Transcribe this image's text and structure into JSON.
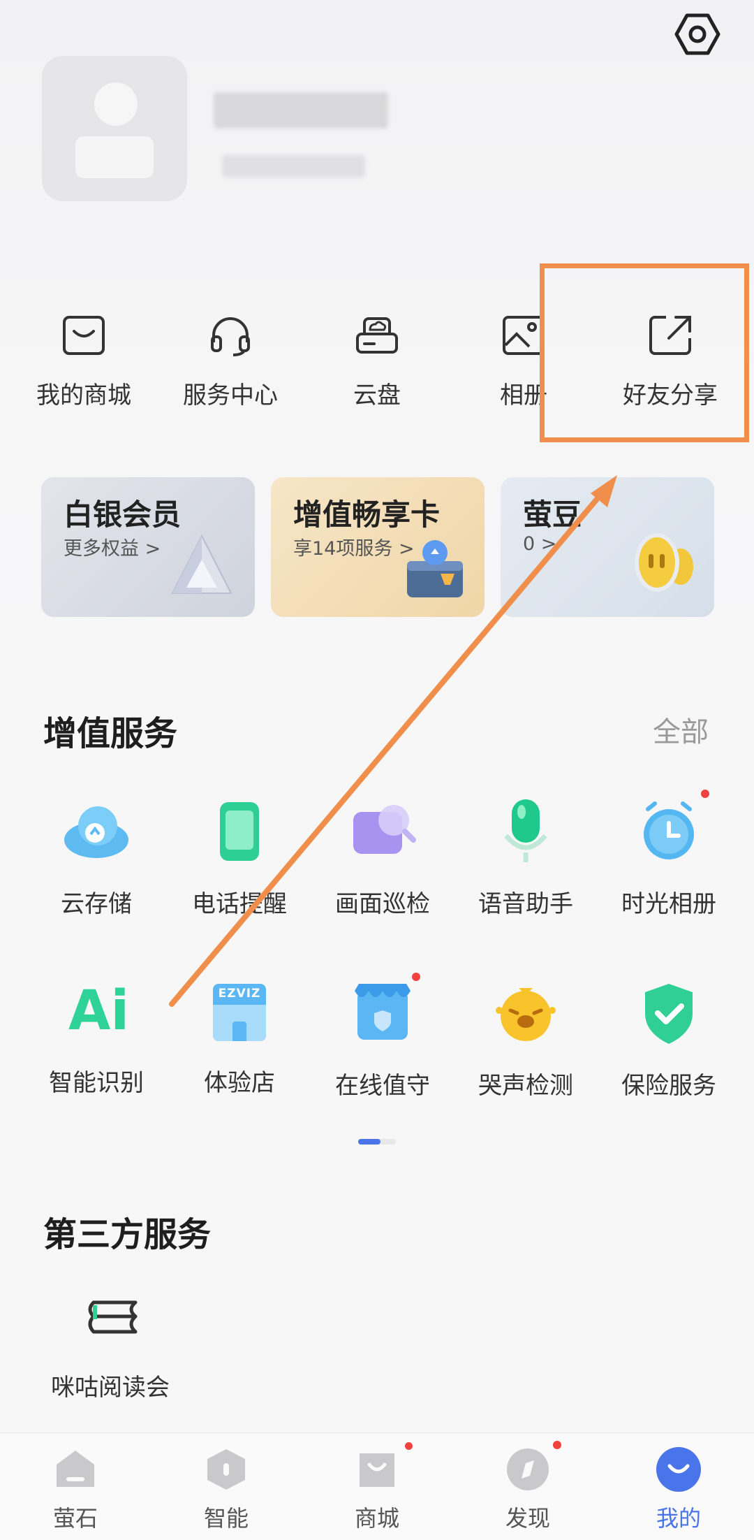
{
  "header": {
    "settings_icon": "hexagon-settings-icon"
  },
  "profile": {
    "avatar_icon": "default-avatar"
  },
  "quick_menu": [
    {
      "label": "我的商城",
      "icon": "shopping-bag-icon"
    },
    {
      "label": "服务中心",
      "icon": "headset-icon"
    },
    {
      "label": "云盘",
      "icon": "cloud-drive-icon"
    },
    {
      "label": "相册",
      "icon": "photo-album-icon"
    },
    {
      "label": "好友分享",
      "icon": "share-icon"
    }
  ],
  "cards": [
    {
      "title": "白银会员",
      "subtitle": "更多权益",
      "chevron": ">"
    },
    {
      "title": "增值畅享卡",
      "subtitle": "享14项服务",
      "chevron": ">"
    },
    {
      "title": "萤豆",
      "subtitle": "0",
      "chevron": ">"
    }
  ],
  "value_services": {
    "title": "增值服务",
    "more": "全部",
    "items": [
      {
        "label": "云存储",
        "icon": "cloud-upload-icon"
      },
      {
        "label": "电话提醒",
        "icon": "phone-icon"
      },
      {
        "label": "画面巡检",
        "icon": "inspect-icon"
      },
      {
        "label": "语音助手",
        "icon": "microphone-icon"
      },
      {
        "label": "时光相册",
        "icon": "clock-icon"
      },
      {
        "label": "智能识别",
        "icon": "ai-icon",
        "ai_text": "Ai"
      },
      {
        "label": "体验店",
        "icon": "store-icon",
        "store_text": "EZVIZ"
      },
      {
        "label": "在线值守",
        "icon": "shop-shield-icon"
      },
      {
        "label": "哭声检测",
        "icon": "crying-face-icon"
      },
      {
        "label": "保险服务",
        "icon": "shield-check-icon"
      }
    ]
  },
  "third_party": {
    "title": "第三方服务",
    "items": [
      {
        "label": "咪咕阅读会",
        "icon": "book-icon"
      }
    ]
  },
  "tabs": [
    {
      "label": "萤石",
      "icon": "home-icon"
    },
    {
      "label": "智能",
      "icon": "smart-icon"
    },
    {
      "label": "商城",
      "icon": "mall-icon"
    },
    {
      "label": "发现",
      "icon": "discover-icon"
    },
    {
      "label": "我的",
      "icon": "me-icon"
    }
  ],
  "colors": {
    "accent": "#4a74ea",
    "annotation": "#ef8f4b",
    "badge": "#f0423f"
  }
}
